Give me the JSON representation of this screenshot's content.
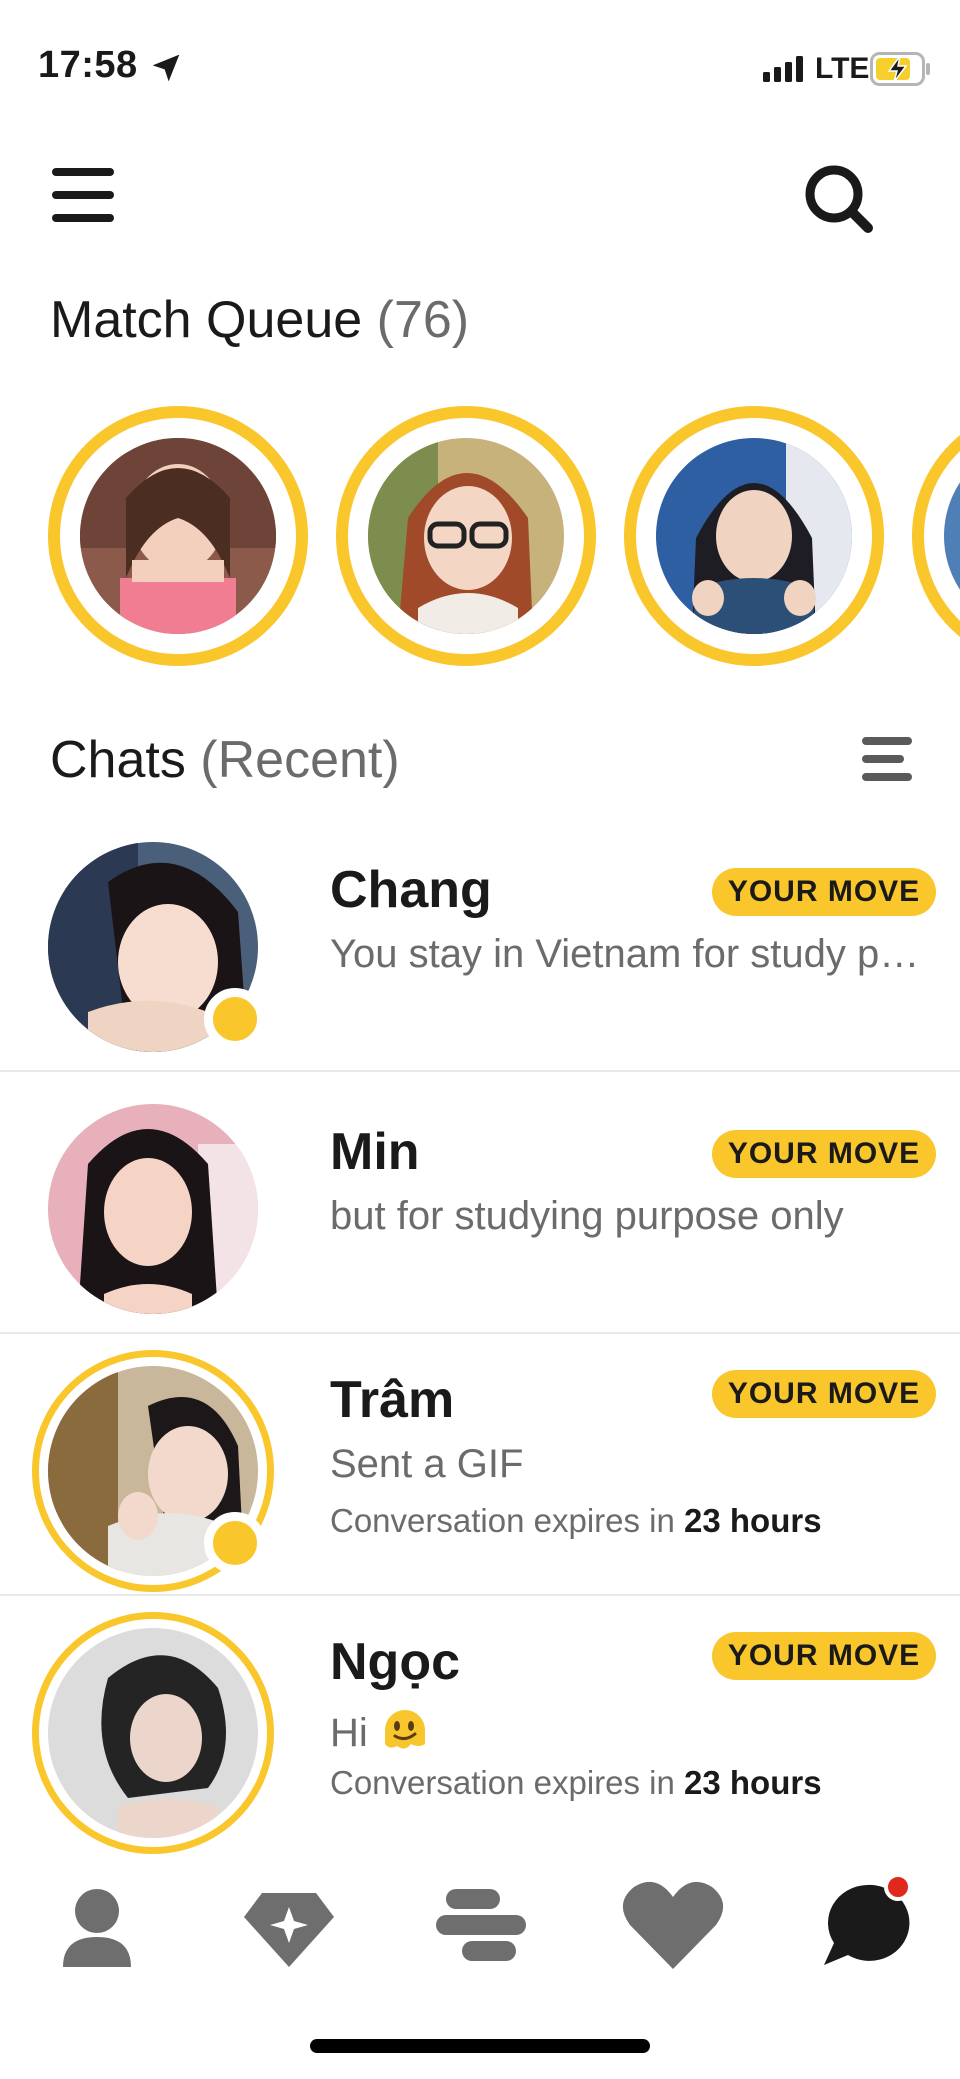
{
  "status_bar": {
    "time": "17:58",
    "network": "LTE",
    "icons": [
      "location-arrow-icon",
      "signal-icon",
      "battery-charging-icon"
    ]
  },
  "header": {
    "icons": [
      "hamburger-menu-icon",
      "search-icon"
    ]
  },
  "match_queue": {
    "title": "Match Queue",
    "count": "(76)",
    "ring_color": "#f9c62b",
    "items": [
      {
        "avatar": "match-avatar-1"
      },
      {
        "avatar": "match-avatar-2"
      },
      {
        "avatar": "match-avatar-3"
      },
      {
        "avatar": "match-avatar-4"
      }
    ]
  },
  "chats": {
    "title": "Chats",
    "filter": "(Recent)",
    "sort_icon": "sort-icon",
    "items": [
      {
        "name": "Chang",
        "badge": "YOUR MOVE",
        "preview": "You stay in Vietnam for study purpose"
      },
      {
        "name": "Min",
        "badge": "YOUR MOVE",
        "preview": "but for studying purpose only"
      },
      {
        "name": "Trâm",
        "badge": "YOUR MOVE",
        "preview": "Sent a GIF",
        "expiry_prefix": "Conversation expires in",
        "expiry_value": "23 hours"
      },
      {
        "name": "Ngọc",
        "badge": "YOUR MOVE",
        "preview": "Hi",
        "preview_emoji": "melting-face-emoji",
        "expiry_prefix": "Conversation expires in",
        "expiry_value": "23 hours"
      }
    ]
  },
  "bottom_nav": {
    "items": [
      "profile-icon",
      "premium-diamond-icon",
      "discover-icon",
      "likes-heart-icon",
      "chat-bubble-icon"
    ],
    "active": "chat-bubble-icon",
    "notification_color": "#e0291c"
  },
  "colors": {
    "accent": "#f9c62b",
    "text": "#1a1a1a",
    "muted": "#6b6b6b",
    "nav_icon": "#6e6e6e"
  }
}
